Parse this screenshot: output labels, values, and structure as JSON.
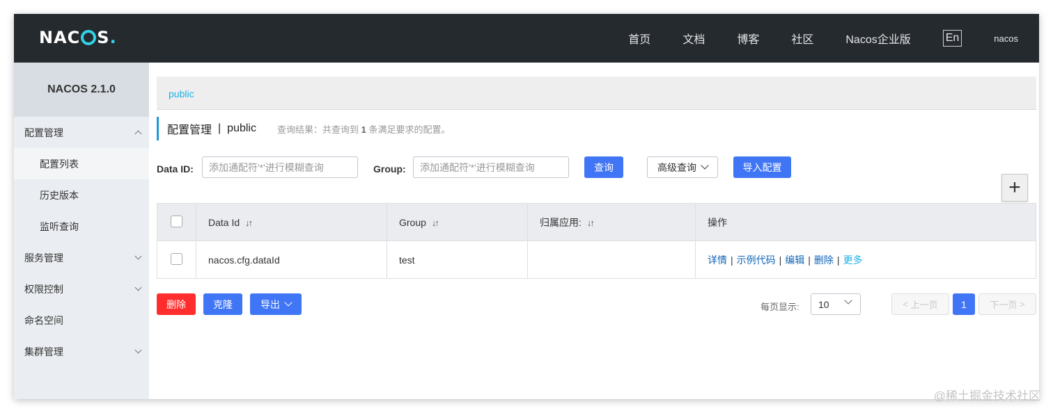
{
  "topbar": {
    "logo": "NACOS.",
    "nav": [
      "首页",
      "文档",
      "博客",
      "社区",
      "Nacos企业版"
    ],
    "lang": "En",
    "user": "nacos"
  },
  "sidebar": {
    "version": "NACOS 2.1.0",
    "items": [
      {
        "label": "配置管理",
        "expanded": true
      },
      {
        "label": "配置列表",
        "sub": true,
        "active": true
      },
      {
        "label": "历史版本",
        "sub": true
      },
      {
        "label": "监听查询",
        "sub": true
      },
      {
        "label": "服务管理",
        "expanded": false
      },
      {
        "label": "权限控制",
        "expanded": false
      },
      {
        "label": "命名空间"
      },
      {
        "label": "集群管理",
        "expanded": false
      }
    ]
  },
  "namespace_bar": {
    "active": "public"
  },
  "title": {
    "module": "配置管理",
    "separator": "|",
    "namespace": "public",
    "result_prefix": "查询结果：共查询到",
    "result_count": "1",
    "result_suffix": "条满足要求的配置。"
  },
  "search": {
    "data_id_label": "Data ID:",
    "data_id_placeholder": "添加通配符'*'进行模糊查询",
    "group_label": "Group:",
    "group_placeholder": "添加通配符'*'进行模糊查询",
    "query_button": "查询",
    "advanced_button": "高级查询",
    "import_button": "导入配置",
    "add_button": "+"
  },
  "table": {
    "headers": [
      "Data Id",
      "Group",
      "归属应用:",
      "操作"
    ],
    "rows": [
      {
        "data_id": "nacos.cfg.dataId",
        "group": "test",
        "app": ""
      }
    ],
    "ops": [
      "详情",
      "示例代码",
      "编辑",
      "删除",
      "更多"
    ]
  },
  "bottom": {
    "delete_button": "删除",
    "clone_button": "克隆",
    "export_button": "导出",
    "page_size_label": "每页显示:",
    "page_size": "10",
    "prev": "上一页",
    "current_page": "1",
    "next": "下一页"
  },
  "watermark": "@稀土掘金技术社区",
  "colors": {
    "topbar": "#252a2f",
    "primary": "#4076f5",
    "danger": "#ff2d2d",
    "link": "#1065b8",
    "accent": "#1ab1e8"
  }
}
